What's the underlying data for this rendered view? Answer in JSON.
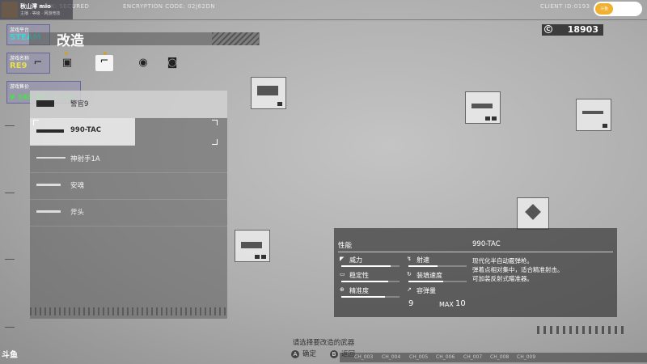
{
  "header": {
    "link": "LINK: SECURED",
    "encryption": "ENCRYPTION CODE: 02J62DN",
    "client": "CLIENT ID:0193"
  },
  "streamer": {
    "name": "秋山澪 mio",
    "sub": "主播 · 等级 · 网游竞技",
    "platform_label": "游戏平台",
    "platform_value": "STEAM",
    "game_label": "游戏名称",
    "game_value": "RE9",
    "price_label": "游戏售价",
    "price_value": "¥ 348 豪华 ¥ 306",
    "pill_label": "斗鱼"
  },
  "page": {
    "title": "改造",
    "currency_symbol": "C",
    "currency_amount": "18903"
  },
  "categories": [
    {
      "icon": "handgun-icon",
      "glyph": "⌐",
      "active": false
    },
    {
      "icon": "pouch-icon",
      "glyph": "▣",
      "active": false
    },
    {
      "icon": "shotgun-icon",
      "glyph": "⌐",
      "active": true
    },
    {
      "icon": "grenade-icon",
      "glyph": "◉",
      "active": false
    },
    {
      "icon": "camera-icon",
      "glyph": "◙",
      "active": false
    }
  ],
  "weapons": [
    {
      "name": "警官9"
    },
    {
      "name": "990-TAC"
    },
    {
      "name": "神射手1A"
    },
    {
      "name": "安魂"
    },
    {
      "name": "斧头"
    }
  ],
  "stats_panel": {
    "header_left": "性能",
    "header_right": "990-TAC",
    "stats": [
      {
        "label": "威力",
        "icon": "◤",
        "level": 0.85
      },
      {
        "label": "射速",
        "icon": "↯",
        "level": 0.5
      },
      {
        "label": "稳定性",
        "icon": "▭",
        "level": 0.8
      },
      {
        "label": "装填速度",
        "icon": "↻",
        "level": 0.6
      },
      {
        "label": "精准度",
        "icon": "⊕",
        "level": 0.75
      },
      {
        "label": "容弹量",
        "icon": "↗",
        "level": 0.9
      }
    ],
    "capacity": "9",
    "max_label": "MAX",
    "max_value": "10",
    "description": [
      "现代化半自动霰弹枪。",
      "弹着点相对集中，适合精准射击。",
      "可加装反射式瞄准器。"
    ]
  },
  "footer": {
    "hint": "请选择要改造的武器",
    "confirm_key": "A",
    "confirm_label": "确定",
    "back_key": "B",
    "back_label": "返回",
    "logo": "斗鱼",
    "chapters": [
      "CH_003",
      "CH_004",
      "CH_005",
      "CH_006",
      "CH_007",
      "CH_008",
      "CH_009"
    ]
  }
}
